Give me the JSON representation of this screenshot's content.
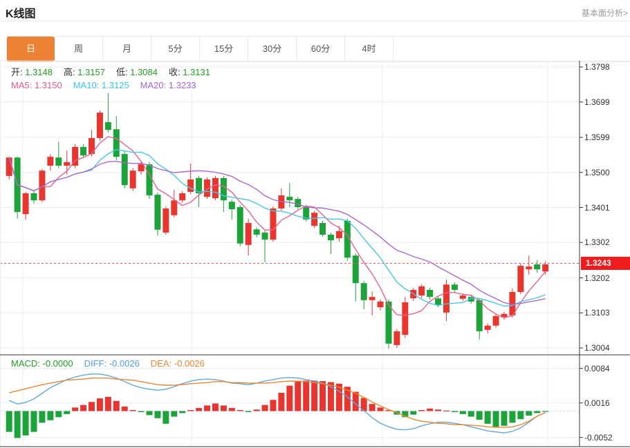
{
  "header": {
    "title": "K线图",
    "link": "基本面分析>"
  },
  "tabs": {
    "selected": 0,
    "items": [
      "日",
      "周",
      "月",
      "5分",
      "15分",
      "30分",
      "60分",
      "4时"
    ]
  },
  "legend": {
    "ohlc": [
      {
        "label": "开:",
        "value": "1.3148"
      },
      {
        "label": "高:",
        "value": "1.3157"
      },
      {
        "label": "低:",
        "value": "1.3084"
      },
      {
        "label": "收:",
        "value": "1.3131"
      }
    ],
    "ma": [
      {
        "label": "MA5:",
        "value": "1.3150",
        "color": "#f0548e"
      },
      {
        "label": "MA10:",
        "value": "1.3125",
        "color": "#33c7ee"
      },
      {
        "label": "MA20:",
        "value": "1.3233",
        "color": "#a95fd8"
      }
    ],
    "macd": [
      {
        "label": "MACD:",
        "value": "-0.0000",
        "color": "#21a121"
      },
      {
        "label": "DIFF:",
        "value": "-0.0026",
        "color": "#4f9ee8"
      },
      {
        "label": "DEA:",
        "value": "-0.0026",
        "color": "#f0862c"
      }
    ]
  },
  "colors": {
    "up": "#e8352e",
    "down": "#1ca43b",
    "ma5": "#ee5f8f",
    "ma10": "#45c8e8",
    "ma20": "#af66cf",
    "diff": "#5fa8e0",
    "dea": "#f0862c",
    "tab_active": "#ee8234",
    "price_tag": "#ee1c1c",
    "price_line": "#f75b4b",
    "ohlc_value": "#21a121",
    "grid": "#e9eef5",
    "axis": "#333333",
    "zero_line": "#b8d8f0"
  },
  "chart_data": {
    "type": "candlestick",
    "title": "K线图 (daily K-line with MACD)",
    "main_panel": {
      "y_ticks": [
        "1.3798",
        "1.3699",
        "1.3599",
        "1.3500",
        "1.3401",
        "1.3302",
        "1.3202",
        "1.3103",
        "1.3004"
      ],
      "ylim": [
        1.299,
        1.3815
      ],
      "current_price": "1.3243",
      "ma_periods": [
        5,
        10,
        20
      ],
      "candles": [
        [
          1.349,
          1.3545,
          1.348,
          1.3542
        ],
        [
          1.3542,
          1.3545,
          1.3369,
          1.3388
        ],
        [
          1.3382,
          1.3445,
          1.3367,
          1.3441
        ],
        [
          1.3441,
          1.3448,
          1.3412,
          1.3421
        ],
        [
          1.3421,
          1.351,
          1.3416,
          1.3505
        ],
        [
          1.3519,
          1.3552,
          1.3505,
          1.3544
        ],
        [
          1.3542,
          1.3587,
          1.3512,
          1.3519
        ],
        [
          1.3519,
          1.3562,
          1.3494,
          1.3529
        ],
        [
          1.3519,
          1.358,
          1.3512,
          1.3572
        ],
        [
          1.3572,
          1.358,
          1.354,
          1.3548
        ],
        [
          1.3552,
          1.362,
          1.3545,
          1.3597
        ],
        [
          1.3597,
          1.3675,
          1.359,
          1.3669
        ],
        [
          1.3642,
          1.3724,
          1.3612,
          1.362
        ],
        [
          1.3622,
          1.3659,
          1.3535,
          1.3544
        ],
        [
          1.3552,
          1.356,
          1.3455,
          1.3464
        ],
        [
          1.3455,
          1.3512,
          1.3448,
          1.3505
        ],
        [
          1.3503,
          1.353,
          1.3494,
          1.3523
        ],
        [
          1.3523,
          1.353,
          1.3425,
          1.3435
        ],
        [
          1.3437,
          1.3443,
          1.3322,
          1.3338
        ],
        [
          1.333,
          1.3404,
          1.3324,
          1.3398
        ],
        [
          1.3379,
          1.3451,
          1.3373,
          1.3421
        ],
        [
          1.3421,
          1.3447,
          1.3414,
          1.3441
        ],
        [
          1.3445,
          1.3525,
          1.3439,
          1.348
        ],
        [
          1.3484,
          1.349,
          1.3402,
          1.3441
        ],
        [
          1.3431,
          1.3486,
          1.3425,
          1.348
        ],
        [
          1.3427,
          1.349,
          1.3421,
          1.3484
        ],
        [
          1.3484,
          1.349,
          1.3388,
          1.3421
        ],
        [
          1.3417,
          1.3423,
          1.3367,
          1.3396
        ],
        [
          1.3402,
          1.3408,
          1.3291,
          1.3299
        ],
        [
          1.3295,
          1.3369,
          1.3265,
          1.3357
        ],
        [
          1.3339,
          1.3345,
          1.3316,
          1.3324
        ],
        [
          1.333,
          1.3336,
          1.3246,
          1.331
        ],
        [
          1.331,
          1.3404,
          1.3304,
          1.3398
        ],
        [
          1.3398,
          1.3455,
          1.3392,
          1.3435
        ],
        [
          1.3431,
          1.347,
          1.3402,
          1.3421
        ],
        [
          1.3425,
          1.3431,
          1.3396,
          1.3402
        ],
        [
          1.3402,
          1.3408,
          1.3361,
          1.3367
        ],
        [
          1.3349,
          1.3392,
          1.3343,
          1.3386
        ],
        [
          1.3357,
          1.3363,
          1.3318,
          1.3324
        ],
        [
          1.3324,
          1.333,
          1.3269,
          1.3308
        ],
        [
          1.3314,
          1.3349,
          1.3304,
          1.3334
        ],
        [
          1.3363,
          1.3369,
          1.3251,
          1.3259
        ],
        [
          1.3265,
          1.3271,
          1.3135,
          1.3187
        ],
        [
          1.3187,
          1.3193,
          1.3113,
          1.3139
        ],
        [
          1.3139,
          1.3164,
          1.3096,
          1.3148
        ],
        [
          1.3119,
          1.3141,
          1.311,
          1.3135
        ],
        [
          1.3135,
          1.3141,
          1.3002,
          1.3016
        ],
        [
          1.3012,
          1.3057,
          1.3004,
          1.3051
        ],
        [
          1.3041,
          1.3148,
          1.3032,
          1.3133
        ],
        [
          1.3144,
          1.3174,
          1.3137,
          1.3168
        ],
        [
          1.3152,
          1.3184,
          1.3144,
          1.3178
        ],
        [
          1.3168,
          1.3174,
          1.3141,
          1.3148
        ],
        [
          1.3144,
          1.315,
          1.3119,
          1.3125
        ],
        [
          1.3104,
          1.3197,
          1.308,
          1.3183
        ],
        [
          1.3183,
          1.3189,
          1.3161,
          1.3168
        ],
        [
          1.3143,
          1.3158,
          1.3137,
          1.3152
        ],
        [
          1.3148,
          1.3154,
          1.3129,
          1.3135
        ],
        [
          1.3139,
          1.3145,
          1.3028,
          1.3051
        ],
        [
          1.3055,
          1.3073,
          1.3045,
          1.3067
        ],
        [
          1.3067,
          1.31,
          1.3061,
          1.3094
        ],
        [
          1.309,
          1.3106,
          1.3084,
          1.31
        ],
        [
          1.3096,
          1.3172,
          1.309,
          1.3162
        ],
        [
          1.3162,
          1.3242,
          1.3156,
          1.3236
        ],
        [
          1.3226,
          1.3265,
          1.3211,
          1.3234
        ],
        [
          1.324,
          1.3252,
          1.3216,
          1.3226
        ],
        [
          1.322,
          1.3249,
          1.3211,
          1.324
        ]
      ]
    },
    "macd_panel": {
      "y_ticks": [
        "0.0084",
        "0.0016",
        "-0.0052"
      ],
      "unit": 0.0001,
      "hist": [
        -41,
        -53,
        -48,
        -41,
        -23,
        -18,
        -12,
        -6,
        7,
        12,
        18,
        25,
        28,
        20,
        9,
        2,
        -2,
        -8,
        -14,
        -25,
        -11,
        -4,
        2,
        6,
        11,
        15,
        11,
        6,
        2,
        -2,
        3,
        12,
        22,
        36,
        50,
        58,
        60,
        60,
        59,
        57,
        54,
        48,
        38,
        26,
        14,
        7,
        2,
        -7,
        -12,
        -7,
        2,
        5,
        3,
        1,
        -2,
        -6,
        -11,
        -17,
        -25,
        -31,
        -29,
        -23,
        -16,
        -9,
        -4,
        -1
      ],
      "diff": [
        21,
        14,
        17,
        24,
        35,
        46,
        54,
        62,
        67,
        71,
        73,
        73,
        70,
        65,
        58,
        51,
        46,
        43,
        41,
        43,
        48,
        54,
        59,
        62,
        63,
        62,
        59,
        55,
        54,
        52,
        55,
        59,
        62,
        65,
        66,
        65,
        62,
        59,
        55,
        48,
        39,
        28,
        14,
        1,
        -13,
        -24,
        -31,
        -36,
        -37,
        -35,
        -29,
        -25,
        -22,
        -22,
        -24,
        -27,
        -31,
        -35,
        -39,
        -41,
        -43,
        -40,
        -33,
        -22,
        -10,
        -3
      ],
      "dea": [
        36,
        40,
        44,
        48,
        52,
        55,
        58,
        61,
        62,
        63,
        65,
        65,
        65,
        63,
        62,
        61,
        58,
        55,
        52,
        51,
        51,
        52,
        54,
        55,
        56,
        58,
        58,
        56,
        56,
        55,
        55,
        55,
        56,
        58,
        59,
        59,
        58,
        56,
        54,
        51,
        47,
        41,
        35,
        27,
        18,
        10,
        3,
        -3,
        -10,
        -16,
        -20,
        -22,
        -24,
        -25,
        -27,
        -27,
        -28,
        -29,
        -31,
        -32,
        -32,
        -31,
        -27,
        -20,
        -10,
        -3
      ]
    }
  }
}
